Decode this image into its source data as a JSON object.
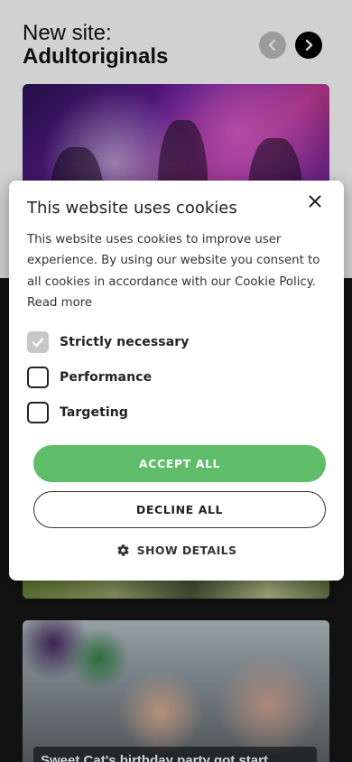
{
  "page": {
    "heading_line1": "New site:",
    "heading_line2": "Adultoriginals",
    "video_title": "Sweet Cat's birthday party got start"
  },
  "carousel": {
    "prev_icon": "chevron-left-icon",
    "next_icon": "chevron-right-icon"
  },
  "cookie_modal": {
    "title": "This website uses cookies",
    "body": "This website uses cookies to improve user experience. By using our website you consent to all cookies in accordance with our Cookie Policy.",
    "read_more": "Read more",
    "options": [
      {
        "label": "Strictly necessary",
        "checked": true,
        "disabled": true
      },
      {
        "label": "Performance",
        "checked": false
      },
      {
        "label": "Targeting",
        "checked": false
      }
    ],
    "accept_label": "ACCEPT ALL",
    "decline_label": "DECLINE ALL",
    "details_label": "SHOW DETAILS",
    "close_icon": "close-icon",
    "details_icon": "gear-icon"
  },
  "colors": {
    "accept": "#5fbd6a",
    "checked_box": "#c7c7c7",
    "nav_prev": "#bdbdbd",
    "nav_next": "#000000",
    "page_bg": "#171717"
  }
}
